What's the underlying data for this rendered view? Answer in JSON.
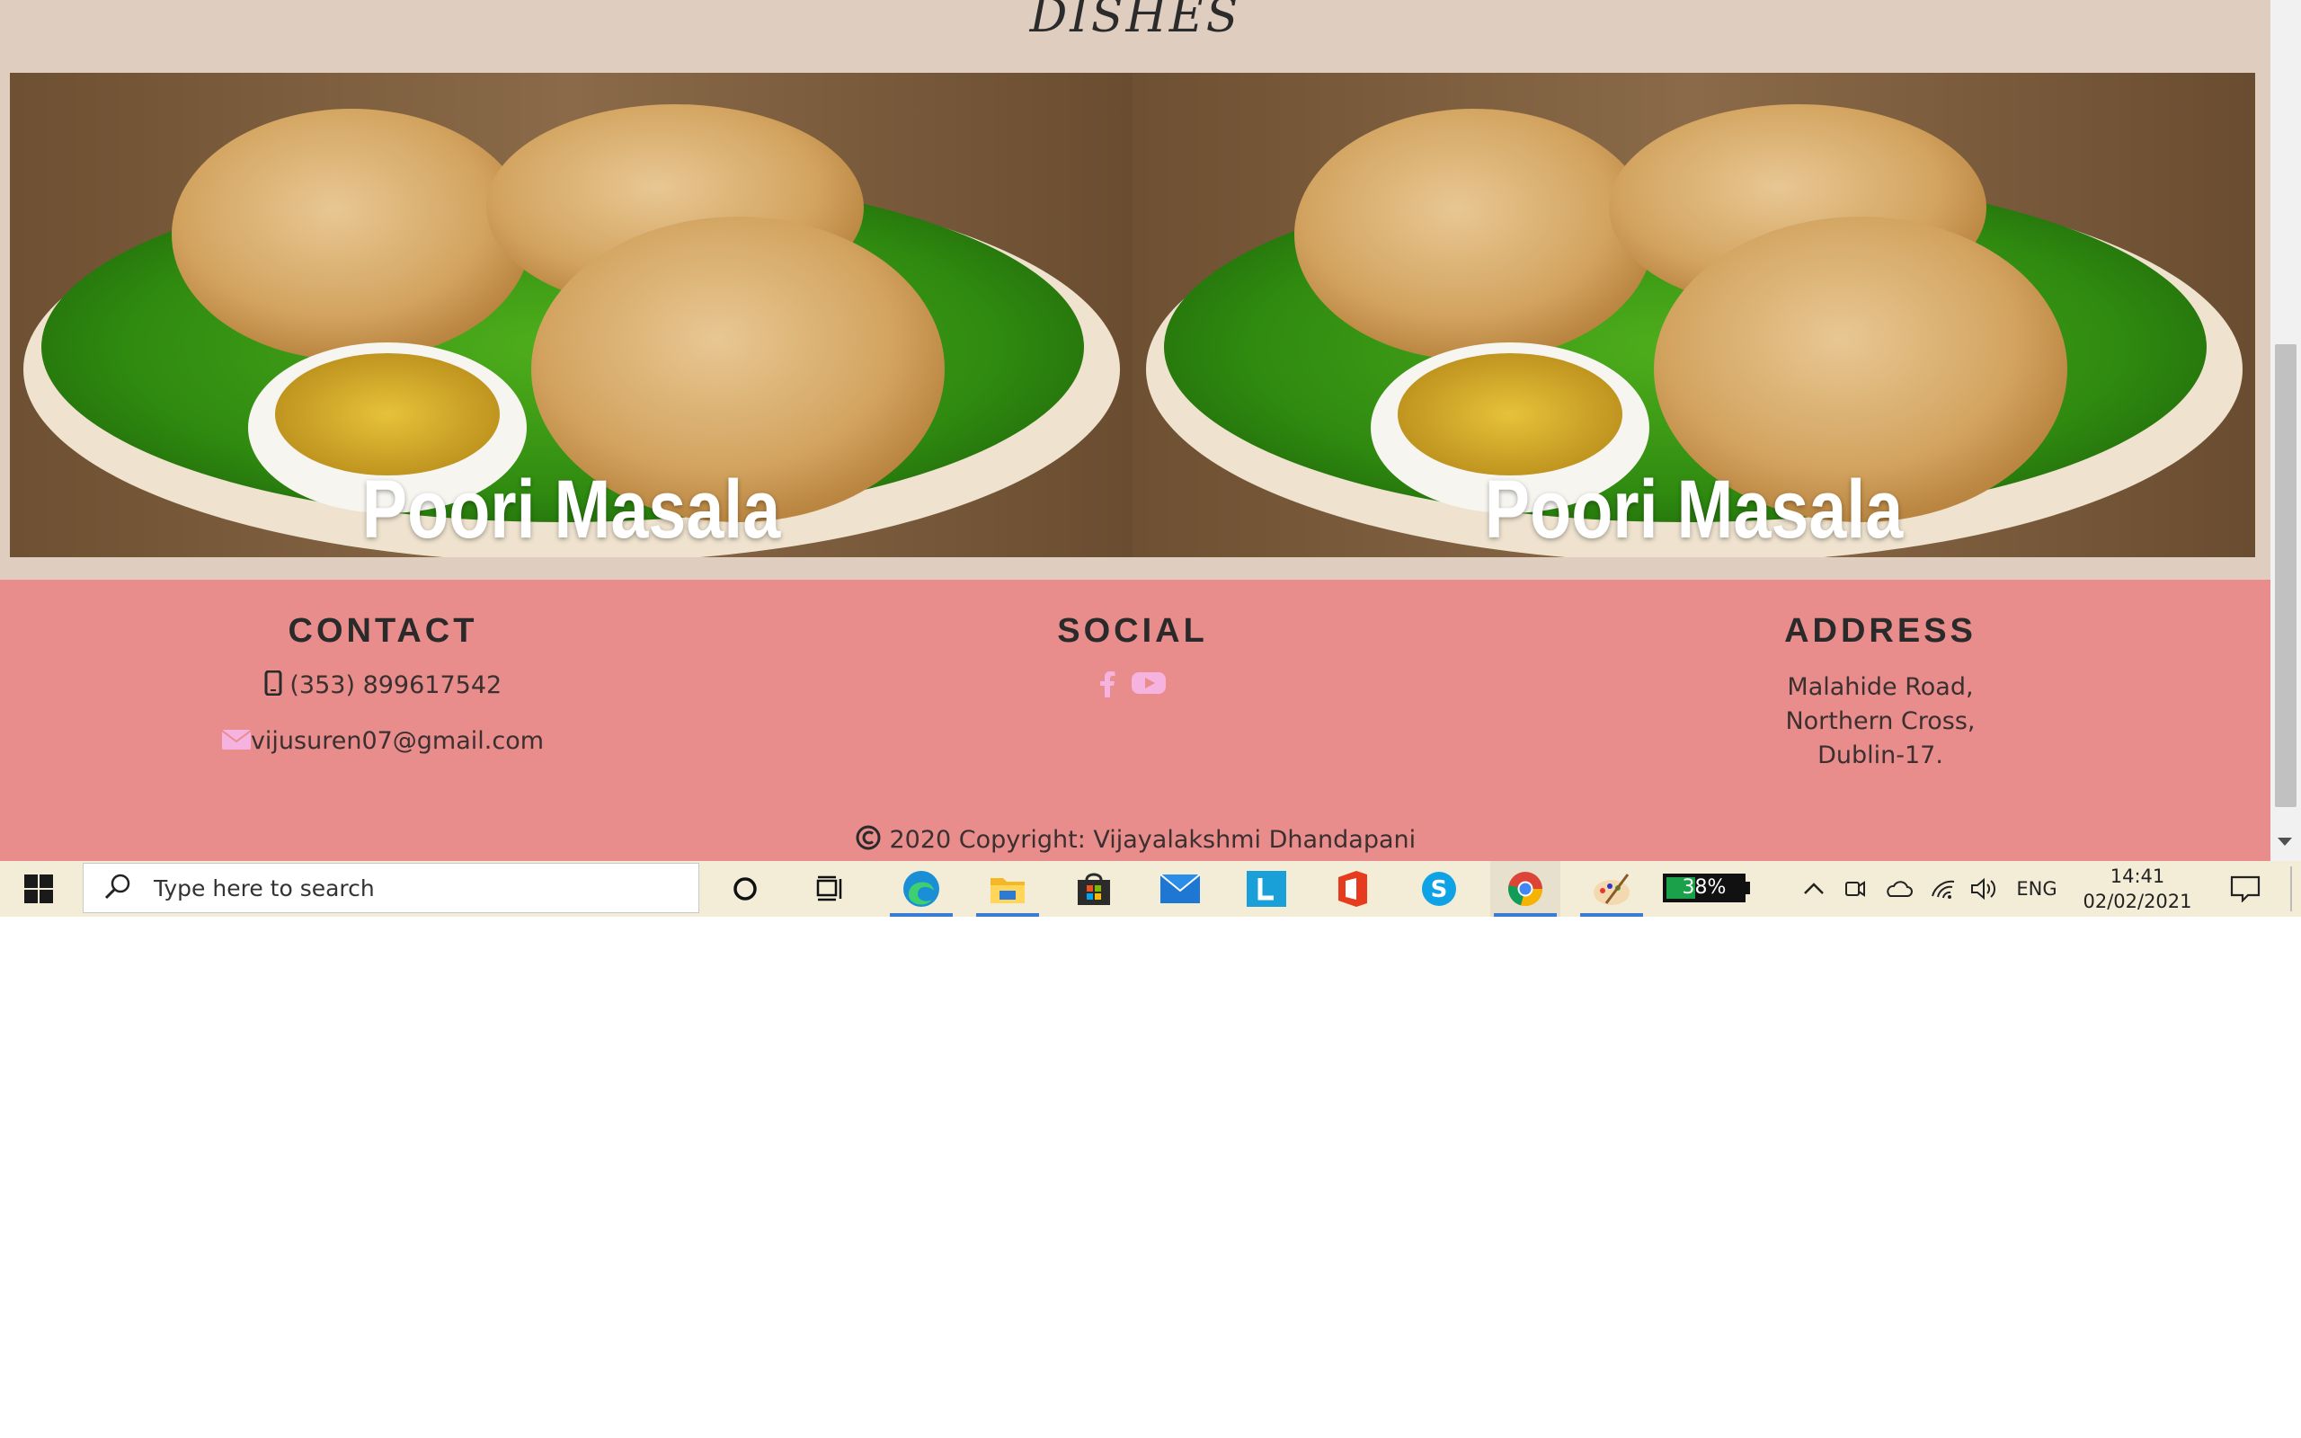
{
  "section": {
    "title": "DISHES"
  },
  "dishes": [
    {
      "name": "Poori Masala",
      "image": "poori-masala-photo"
    },
    {
      "name": "Poori Masala",
      "image": "poori-masala-photo"
    }
  ],
  "footer": {
    "contact": {
      "title": "CONTACT",
      "phone": "(353) 899617542",
      "email": "vijusuren07@gmail.com",
      "phone_icon": "mobile-phone-icon",
      "email_icon": "envelope-icon"
    },
    "social": {
      "title": "SOCIAL",
      "icons": [
        "facebook-icon",
        "youtube-icon"
      ]
    },
    "address": {
      "title": "ADDRESS",
      "lines": [
        "Malahide Road,",
        "Northern Cross,",
        "Dublin-17."
      ]
    },
    "copyright": "2020 Copyright: Vijayalakshmi Dhandapani",
    "copyright_icon": "copyright-icon"
  },
  "taskbar": {
    "search_placeholder": "Type here to search",
    "apps": [
      "cortana-icon",
      "task-view-icon",
      "edge-icon",
      "file-explorer-icon",
      "store-icon",
      "mail-icon",
      "l-app-icon",
      "office-icon",
      "skype-icon",
      "chrome-icon",
      "paint-icon"
    ],
    "battery_percent": "38%",
    "battery_level": 0.38,
    "language": "ENG",
    "time": "14:41",
    "date": "02/02/2021"
  },
  "colors": {
    "page_bg": "#dfcdc0",
    "footer_bg": "#e98c8c",
    "social_icon": "#f7b3e0",
    "accent": "#3a7bd5"
  }
}
